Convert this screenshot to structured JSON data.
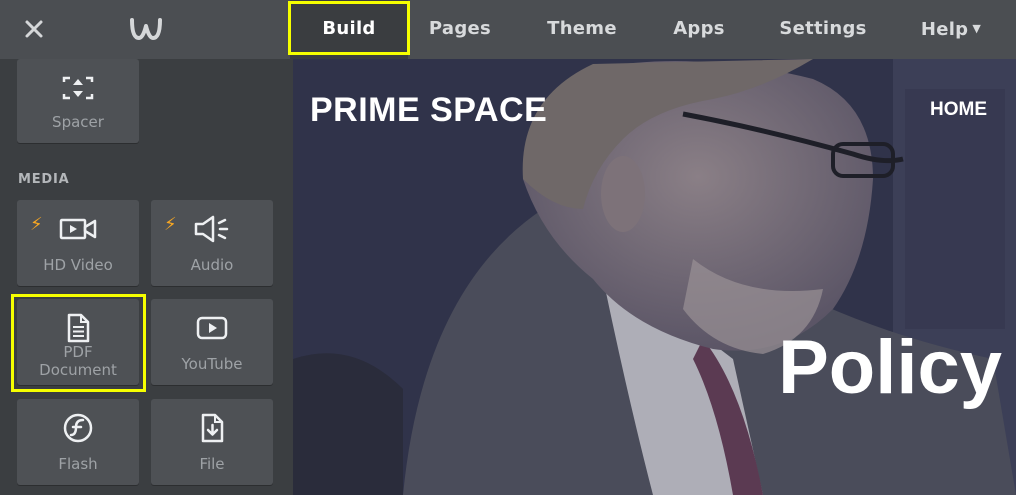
{
  "topbar": {
    "close_icon": "close-icon",
    "logo_icon": "weebly-logo-icon",
    "tabs": [
      {
        "label": "Build",
        "active": true
      },
      {
        "label": "Pages"
      },
      {
        "label": "Theme"
      },
      {
        "label": "Apps"
      },
      {
        "label": "Settings"
      },
      {
        "label": "Help"
      }
    ]
  },
  "sidebar": {
    "spacer": {
      "label": "Spacer",
      "icon": "spacer-icon"
    },
    "media_heading": "MEDIA",
    "media": [
      {
        "label": "HD Video",
        "icon": "video-camera-icon",
        "premium": true
      },
      {
        "label": "Audio",
        "icon": "speaker-icon",
        "premium": true
      },
      {
        "label_line1": "PDF",
        "label_line2": "Document",
        "icon": "document-icon"
      },
      {
        "label": "YouTube",
        "icon": "youtube-icon"
      },
      {
        "label": "Flash",
        "icon": "flash-icon"
      },
      {
        "label": "File",
        "icon": "file-download-icon"
      }
    ]
  },
  "preview": {
    "site_title": "PRIME SPACE",
    "nav_home": "HOME",
    "headline": "Policy"
  },
  "colors": {
    "highlight": "#f6ff00",
    "premium_bolt": "#f6a623",
    "topbar_bg": "#4b4e52",
    "sidebar_bg": "#3b3e41"
  }
}
